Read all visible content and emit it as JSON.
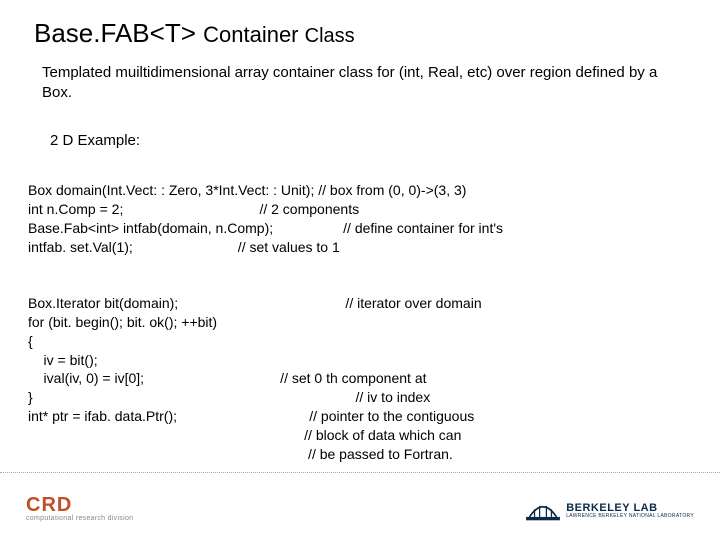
{
  "title": {
    "part1": "Base.",
    "part2": "FAB<T> ",
    "part3": "Container ",
    "part4": "Class"
  },
  "desc": "Templated muiltidimensional array container class for (int, Real, etc) over region defined by a Box.",
  "example_label": "2 D Example:",
  "code_line1": "Box domain(Int.Vect: : Zero, 3*Int.Vect: : Unit); // box from (0, 0)->(3, 3)",
  "code_line2": "int n.Comp = 2;                                   // 2 components",
  "code_line3": "Base.Fab<int> intfab(domain, n.Comp);                  // define container for int's",
  "code_line4": "intfab. set.Val(1);                           // set values to 1",
  "code_line5": "Box.Iterator bit(domain);                                           // iterator over domain",
  "code_line6": "for (bit. begin(); bit. ok(); ++bit)",
  "code_line7": "{",
  "code_line8": "    iv = bit();",
  "code_line9": "    ival(iv, 0) = iv[0];                                   // set 0 th component at",
  "code_line10": "}                                                                                   // iv to index",
  "code_line11": "int* ptr = ifab. data.Ptr();                                  // pointer to the contiguous",
  "code_line12": "                                                                       // block of data which can",
  "code_line13": "                                                                        // be passed to Fortran.",
  "footer": {
    "left_main": "CRD",
    "left_sub": "computational research division",
    "right_main": "BERKELEY LAB",
    "right_sub": "LAWRENCE BERKELEY NATIONAL LABORATORY"
  }
}
